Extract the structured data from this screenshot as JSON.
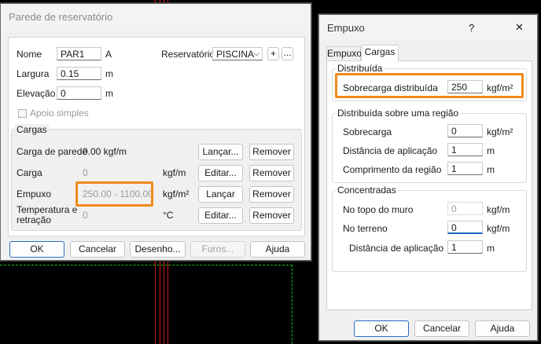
{
  "dialog1": {
    "title": "Parede de reservatório",
    "nome_label": "Nome",
    "nome_value": "PAR1",
    "nome_suffix": "A",
    "largura_label": "Largura",
    "largura_value": "0.15",
    "largura_unit": "m",
    "elevacao_label": "Elevação",
    "elevacao_value": "0",
    "elevacao_unit": "m",
    "apoio_label": "Apoio simples",
    "reservatorio_label": "Reservatório",
    "reservatorio_value": "PISCINA",
    "add_btn": "+",
    "more_btn": "...",
    "cargas_group": "Cargas",
    "carga_parede_label": "Carga de parede",
    "carga_parede_value": "0.00 kgf/m",
    "carga_label": "Carga",
    "carga_value": "0",
    "carga_unit": "kgf/m",
    "empuxo_label": "Empuxo",
    "empuxo_value": "250.00 - 1100.00",
    "empuxo_unit": "kgf/m²",
    "temp_label_1": "Temperatura e",
    "temp_label_2": "retração",
    "temp_value": "0",
    "temp_unit": "°C",
    "btn_lancar": "Lançar...",
    "btn_editar": "Editar...",
    "btn_lancar2": "Lançar",
    "btn_remover": "Remover",
    "ok": "OK",
    "cancelar": "Cancelar",
    "desenho": "Desenho...",
    "furos": "Furos...",
    "ajuda": "Ajuda"
  },
  "dialog2": {
    "title": "Empuxo",
    "help": "?",
    "close": "✕",
    "tabs": [
      "Empuxo",
      "Cargas"
    ],
    "distribuida_group": "Distribuída",
    "sobrecarga_dist_label": "Sobrecarga distribuída",
    "sobrecarga_dist_value": "250",
    "sobrecarga_dist_unit": "kgf/m²",
    "regiao_group": "Distribuída sobre uma região",
    "sobrecarga_label": "Sobrecarga",
    "sobrecarga_value": "0",
    "sobrecarga_unit": "kgf/m²",
    "dist_aplic_label": "Distância de aplicação",
    "dist_aplic_value": "1",
    "dist_aplic_unit": "m",
    "comp_regiao_label": "Comprimento da região",
    "comp_regiao_value": "1",
    "comp_regiao_unit": "m",
    "concentradas_group": "Concentradas",
    "topo_label": "No topo do muro",
    "topo_value": "0",
    "topo_unit": "kgf/m",
    "terreno_label": "No terreno",
    "terreno_value": "0",
    "terreno_unit": "kgf/m",
    "dist_aplic2_label": "Distância de aplicação",
    "dist_aplic2_value": "1",
    "dist_aplic2_unit": "m",
    "ok": "OK",
    "cancelar": "Cancelar",
    "ajuda": "Ajuda"
  },
  "colors": {
    "highlight": "#f08a1c",
    "cad_red": "#d11a1a",
    "cad_green": "#17c21a"
  }
}
